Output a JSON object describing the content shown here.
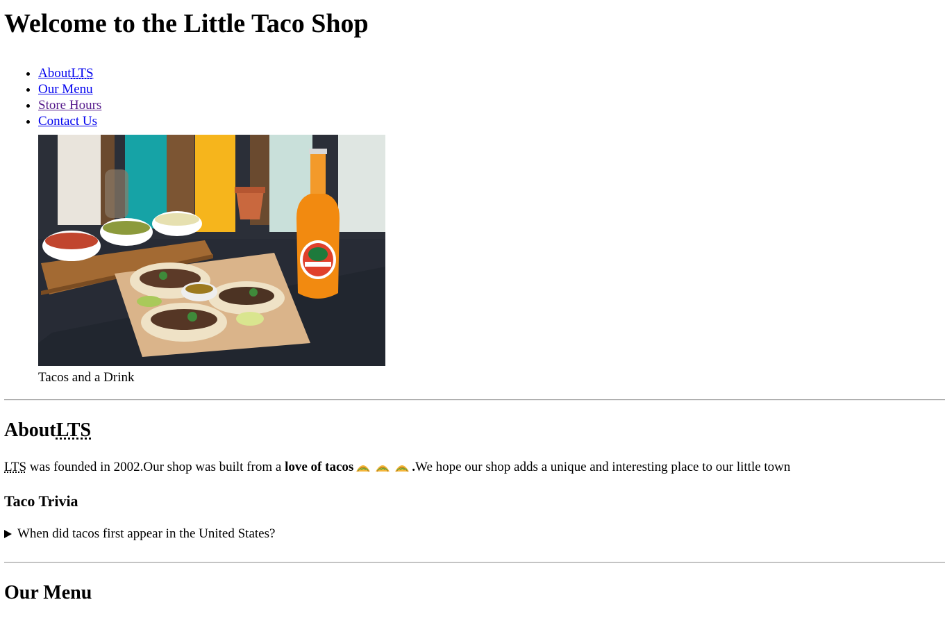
{
  "header": {
    "title": "Welcome to the Little Taco Shop"
  },
  "nav": {
    "items": [
      {
        "label": "About",
        "abbr": "LTS"
      },
      {
        "label": "Our Menu"
      },
      {
        "label": "Store Hours",
        "state": "visited"
      },
      {
        "label": "Contact Us"
      }
    ]
  },
  "figure": {
    "caption": "Tacos and a Drink"
  },
  "about": {
    "heading": "About",
    "heading_abbr": "LTS",
    "abbr": "LTS",
    "text_1": " was founded in 2002.Our shop was built from a ",
    "bold": "love of tacos",
    "emoji": [
      "taco-icon",
      "taco-icon",
      "taco-icon"
    ],
    "period": ".",
    "text_2": "We hope our shop adds a unique and interesting place to our little town"
  },
  "trivia": {
    "heading": "Taco Trivia",
    "summary": "When did tacos first appear in the United States?"
  },
  "menu": {
    "heading": "Our Menu"
  },
  "colors": {
    "link": "#0000ee",
    "visited_link": "#551a8b",
    "text": "#000000",
    "background": "#ffffff"
  }
}
